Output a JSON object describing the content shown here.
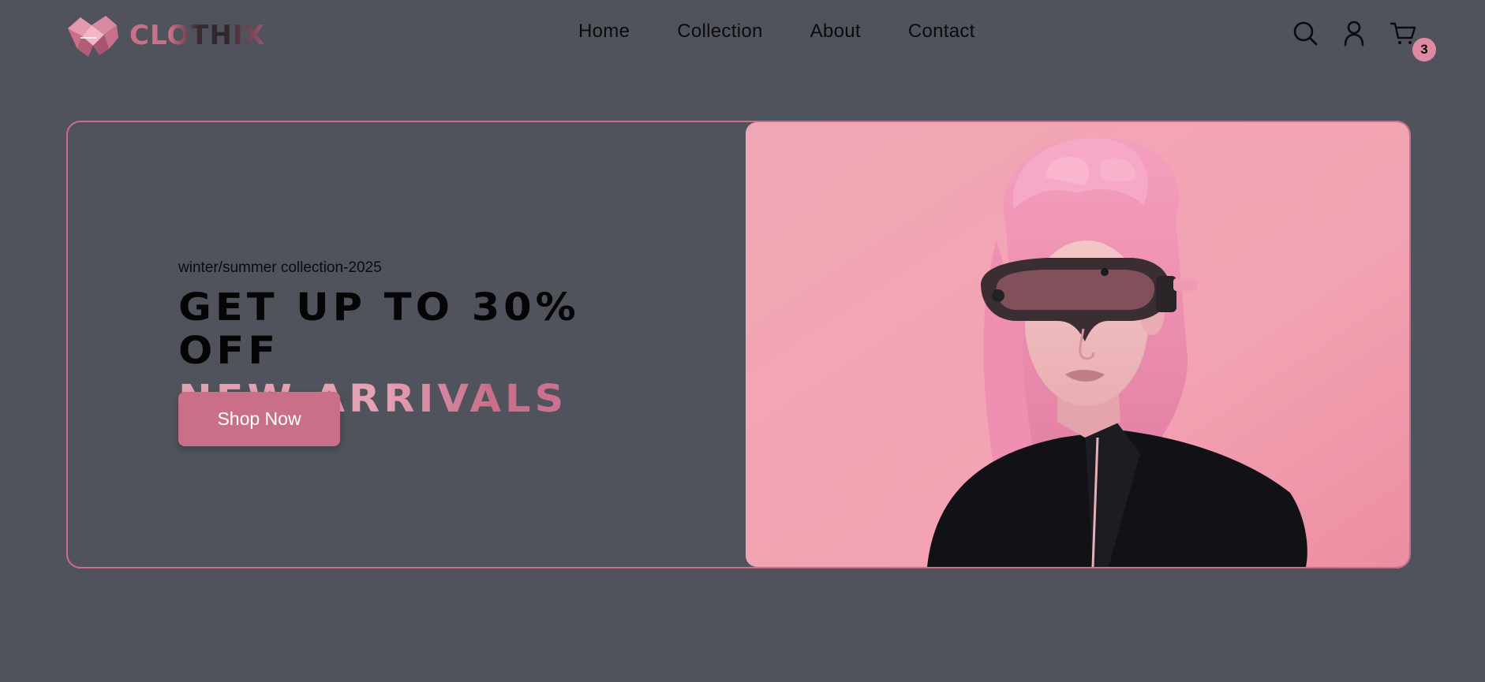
{
  "brand": {
    "name": "CLOTHIX",
    "logo_icon": "origami-fox-logo"
  },
  "nav": {
    "items": [
      {
        "label": "Home"
      },
      {
        "label": "Collection"
      },
      {
        "label": "About"
      },
      {
        "label": "Contact"
      }
    ]
  },
  "header_icons": {
    "search": "search-icon",
    "account": "user-icon",
    "cart": "cart-icon",
    "cart_count": "3"
  },
  "hero": {
    "subtitle": "winter/summer collection-2025",
    "headline": "GET UP TO 30% OFF",
    "headline_accent": "NEW ARRIVALS",
    "cta_label": "Shop Now",
    "image_alt": "woman with pink hair wearing VR goggles"
  },
  "colors": {
    "background": "#51535c",
    "accent": "#c97088",
    "accent_light": "#e6a2b5",
    "text": "#0b0b0d",
    "badge": "#df8aa3"
  }
}
